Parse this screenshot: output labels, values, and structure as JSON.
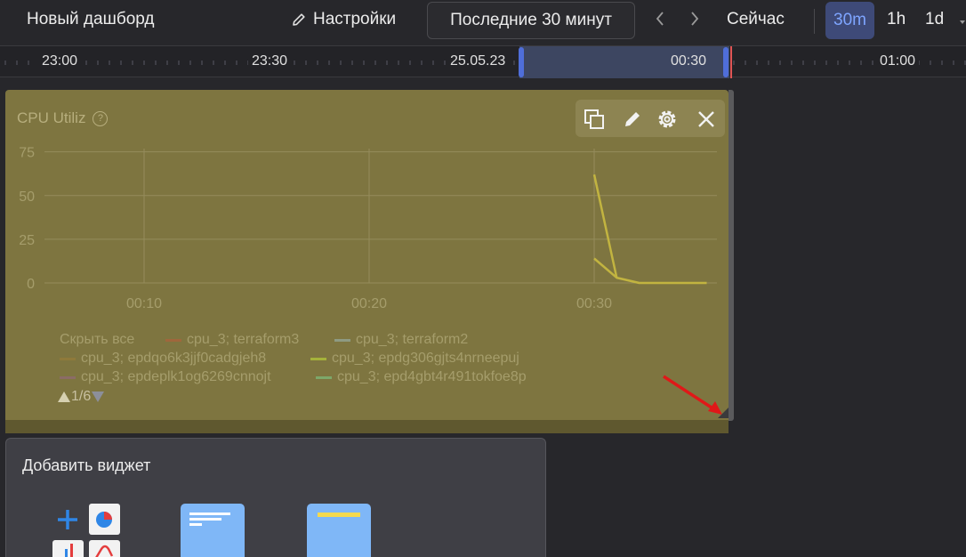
{
  "header": {
    "dashboard_title": "Новый дашборд",
    "settings_label": "Настройки",
    "time_range_label": "Последние 30 минут",
    "prev_icon": "chevron-left-icon",
    "next_icon": "chevron-right-icon",
    "now_label": "Сейчас",
    "zoom_options": [
      "30m",
      "1h",
      "1d"
    ],
    "zoom_selected": "30m",
    "accent_color": "#7ea5ff"
  },
  "timeline": {
    "labels": [
      "23:00",
      "23:30",
      "25.05.23",
      "00:30",
      "01:00"
    ],
    "selection_color": "#3d4661",
    "cursor_color": "#e05555"
  },
  "widget": {
    "title": "CPU Utiliz",
    "help_icon": "?",
    "toolbar_icons": [
      "duplicate-icon",
      "edit-icon",
      "gear-icon",
      "close-icon"
    ],
    "background_color": "#7e7540",
    "legend_hide_all": "Скрыть все",
    "legend": [
      {
        "name": "cpu_3; terraform3",
        "color": "#a0673c"
      },
      {
        "name": "cpu_3; terraform2",
        "color": "#8e9a82"
      },
      {
        "name": "cpu_3; epdqo6k3jjf0cadgjeh8",
        "color": "#8f7a3a"
      },
      {
        "name": "cpu_3; epdg306gjts4nrneepuj",
        "color": "#a5b23a"
      },
      {
        "name": "cpu_3; epdeplk1og6269cnnojt",
        "color": "#8b6c66"
      },
      {
        "name": "cpu_3; epd4gbt4r491tokfoe8p",
        "color": "#7da86a"
      }
    ],
    "pager": "1/6"
  },
  "chart_data": {
    "type": "line",
    "title": "CPU Utiliz",
    "xlabel": "",
    "ylabel": "",
    "x_ticks": [
      "00:10",
      "00:20",
      "00:30"
    ],
    "y_ticks": [
      0,
      25,
      50,
      75
    ],
    "ylim": [
      0,
      85
    ],
    "grid": true,
    "series": [
      {
        "name": "cpu_3; epdqo6k3jjf0cadgjeh8",
        "color": "#c2b440",
        "x": [
          "00:30",
          "00:31",
          "00:32",
          "00:33",
          "00:34",
          "00:35"
        ],
        "values": [
          62,
          3,
          0,
          0,
          0,
          0
        ]
      },
      {
        "name": "cpu_3; epdg306gjts4nrneepuj",
        "color": "#c2b440",
        "x": [
          "00:30",
          "00:31"
        ],
        "values": [
          14,
          3
        ]
      }
    ]
  },
  "add_widget": {
    "title": "Добавить виджет"
  }
}
